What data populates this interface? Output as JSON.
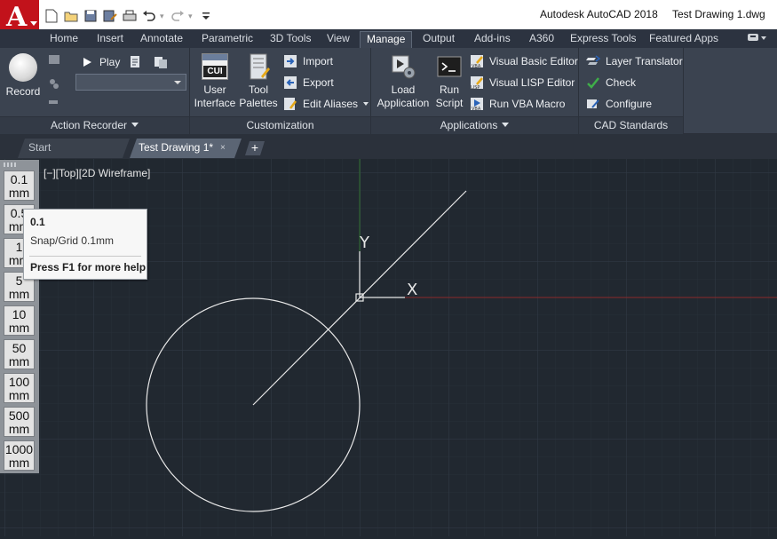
{
  "title_bar": {
    "app_name": "Autodesk AutoCAD 2018",
    "document": "Test Drawing 1.dwg",
    "logo_letter": "A",
    "quick_access": [
      "new-icon",
      "open-icon",
      "save-icon",
      "save-as-icon",
      "plot-icon",
      "undo-icon",
      "redo-icon",
      "customize-icon"
    ]
  },
  "ribbon_tabs": [
    "Home",
    "Insert",
    "Annotate",
    "Parametric",
    "3D Tools",
    "View",
    "Manage",
    "Output",
    "Add-ins",
    "A360",
    "Express Tools",
    "Featured Apps"
  ],
  "active_tab": "Manage",
  "panels": {
    "action_recorder": {
      "title": "Action Recorder",
      "record": "Record",
      "play": "Play",
      "macro_value": ""
    },
    "customization": {
      "title": "Customization",
      "user_interface": [
        "User",
        "Interface"
      ],
      "tool_palettes": [
        "Tool",
        "Palettes"
      ],
      "cui_badge": "CUI",
      "import": "Import",
      "export": "Export",
      "edit_aliases": "Edit Aliases"
    },
    "applications": {
      "title": "Applications",
      "load_application": [
        "Load",
        "Application"
      ],
      "run_script": [
        "Run",
        "Script"
      ],
      "visual_basic_editor": "Visual Basic Editor",
      "visual_lisp_editor": "Visual LISP Editor",
      "run_vba_macro": "Run VBA Macro"
    },
    "cad_standards": {
      "title": "CAD Standards",
      "layer_translator": "Layer Translator",
      "check": "Check",
      "configure": "Configure"
    }
  },
  "file_tabs": {
    "start": "Start",
    "document": "Test Drawing 1*",
    "close": "×",
    "new": "+"
  },
  "viewport_label": "[−][Top][2D Wireframe]",
  "snap_palette": [
    {
      "value": "0.1",
      "unit": "mm"
    },
    {
      "value": "0.5",
      "unit": "mm"
    },
    {
      "value": "1",
      "unit": "mm"
    },
    {
      "value": "5",
      "unit": "mm"
    },
    {
      "value": "10",
      "unit": "mm"
    },
    {
      "value": "50",
      "unit": "mm"
    },
    {
      "value": "100",
      "unit": "mm"
    },
    {
      "value": "500",
      "unit": "mm"
    },
    {
      "value": "1000",
      "unit": "mm"
    }
  ],
  "tooltip": {
    "title": "0.1",
    "description": "Snap/Grid 0.1mm",
    "help": "Press F1 for more help"
  },
  "ucs": {
    "x_label": "X",
    "y_label": "Y"
  },
  "colors": {
    "canvas": "#212830",
    "ribbon": "#3b4350",
    "logo": "#c2121b",
    "x_axis": "#8b2a2a",
    "y_axis": "#2d6b2d",
    "geometry": "#e8e8e8"
  }
}
